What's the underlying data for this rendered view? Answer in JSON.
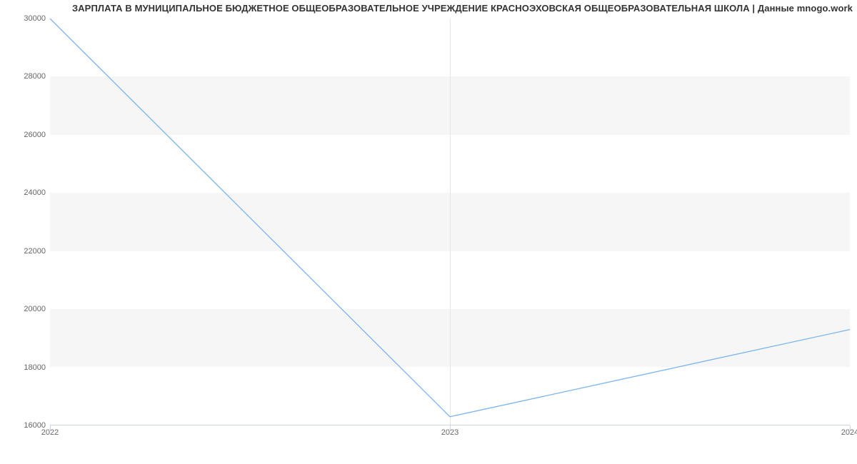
{
  "chart_data": {
    "type": "line",
    "title": "ЗАРПЛАТА В МУНИЦИПАЛЬНОЕ БЮДЖЕТНОЕ ОБЩЕОБРАЗОВАТЕЛЬНОЕ УЧРЕЖДЕНИЕ КРАСНОЭХОВСКАЯ ОБЩЕОБРАЗОВАТЕЛЬНАЯ ШКОЛА | Данные mnogo.work",
    "x": [
      "2022",
      "2023",
      "2024"
    ],
    "y": [
      30000,
      16300,
      19300
    ],
    "xlabel": "",
    "ylabel": "",
    "y_ticks": [
      16000,
      18000,
      20000,
      22000,
      24000,
      26000,
      28000,
      30000
    ],
    "ylim": [
      16000,
      30000
    ],
    "xlim_index": [
      0,
      2
    ],
    "colors": {
      "line": "#7cb5ec",
      "band": "#f6f6f6"
    }
  }
}
